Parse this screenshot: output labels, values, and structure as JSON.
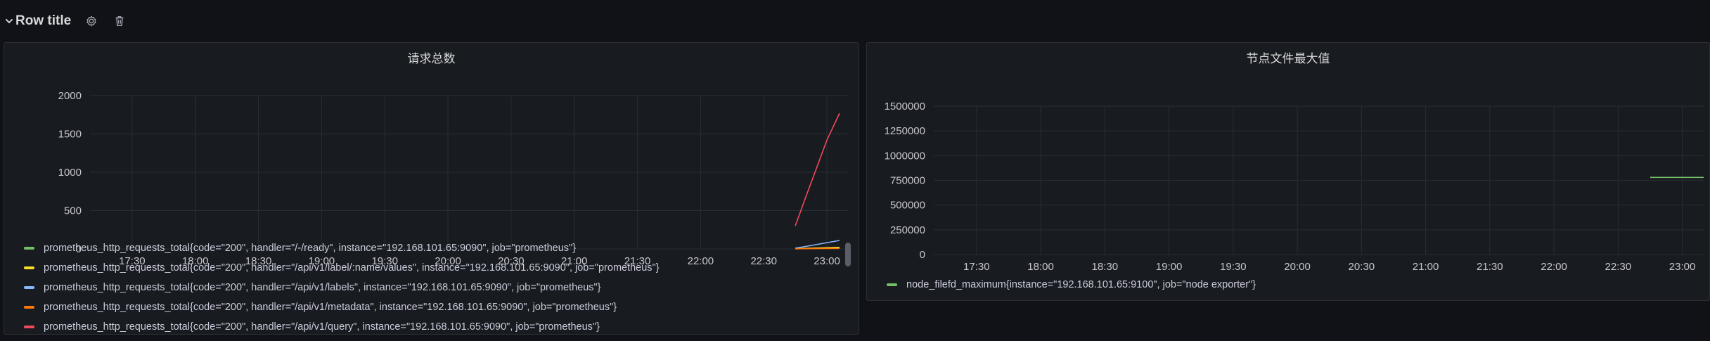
{
  "row": {
    "title": "Row title",
    "icons": [
      "chevron-down-icon",
      "gear-icon",
      "trash-icon"
    ]
  },
  "panels": [
    {
      "title": "请求总数",
      "legend": [
        {
          "label": "prometheus_http_requests_total{code=\"200\", handler=\"/-/ready\", instance=\"192.168.101.65:9090\", job=\"prometheus\"}",
          "color": "#73bf69"
        },
        {
          "label": "prometheus_http_requests_total{code=\"200\", handler=\"/api/v1/label/:name/values\", instance=\"192.168.101.65:9090\", job=\"prometheus\"}",
          "color": "#fade2a"
        },
        {
          "label": "prometheus_http_requests_total{code=\"200\", handler=\"/api/v1/labels\", instance=\"192.168.101.65:9090\", job=\"prometheus\"}",
          "color": "#8ab8ff"
        },
        {
          "label": "prometheus_http_requests_total{code=\"200\", handler=\"/api/v1/metadata\", instance=\"192.168.101.65:9090\", job=\"prometheus\"}",
          "color": "#ff780a"
        },
        {
          "label": "prometheus_http_requests_total{code=\"200\", handler=\"/api/v1/query\", instance=\"192.168.101.65:9090\", job=\"prometheus\"}",
          "color": "#f2495c"
        }
      ]
    },
    {
      "title": "节点文件最大值",
      "legend": [
        {
          "label": "node_filefd_maximum{instance=\"192.168.101.65:9100\", job=\"node exporter\"}",
          "color": "#73bf69"
        }
      ]
    }
  ],
  "chart_data": [
    {
      "type": "line",
      "x_ticks": [
        "17:30",
        "18:00",
        "18:30",
        "19:00",
        "19:30",
        "20:00",
        "20:30",
        "21:00",
        "21:30",
        "22:00",
        "22:30",
        "23:00"
      ],
      "y_ticks": [
        "0",
        "500",
        "1000",
        "1500",
        "2000"
      ],
      "ylim": [
        0,
        2000
      ],
      "xlim": [
        "17:10",
        "23:10"
      ],
      "grid": true,
      "legend_position": "bottom",
      "series": [
        {
          "color": "#73bf69",
          "x": [
            "22:45",
            "23:06"
          ],
          "y": [
            2,
            14
          ]
        },
        {
          "color": "#fade2a",
          "x": [
            "22:45",
            "23:06"
          ],
          "y": [
            3,
            20
          ]
        },
        {
          "color": "#8ab8ff",
          "x": [
            "22:45",
            "23:06"
          ],
          "y": [
            8,
            110
          ]
        },
        {
          "color": "#ff780a",
          "x": [
            "22:45",
            "23:06"
          ],
          "y": [
            2,
            6
          ]
        },
        {
          "color": "#f2495c",
          "x": [
            "22:45",
            "22:50",
            "22:55",
            "23:00",
            "23:06"
          ],
          "y": [
            300,
            680,
            1050,
            1420,
            1770
          ]
        }
      ]
    },
    {
      "type": "line",
      "x_ticks": [
        "17:30",
        "18:00",
        "18:30",
        "19:00",
        "19:30",
        "20:00",
        "20:30",
        "21:00",
        "21:30",
        "22:00",
        "22:30",
        "23:00"
      ],
      "y_ticks": [
        "0",
        "250000",
        "500000",
        "750000",
        "1000000",
        "1250000",
        "1500000"
      ],
      "ylim": [
        0,
        1500000
      ],
      "xlim": [
        "17:10",
        "23:10"
      ],
      "grid": true,
      "legend_position": "bottom",
      "series": [
        {
          "color": "#73bf69",
          "x": [
            "22:45",
            "23:10"
          ],
          "y": [
            780000,
            780000
          ]
        }
      ]
    }
  ]
}
